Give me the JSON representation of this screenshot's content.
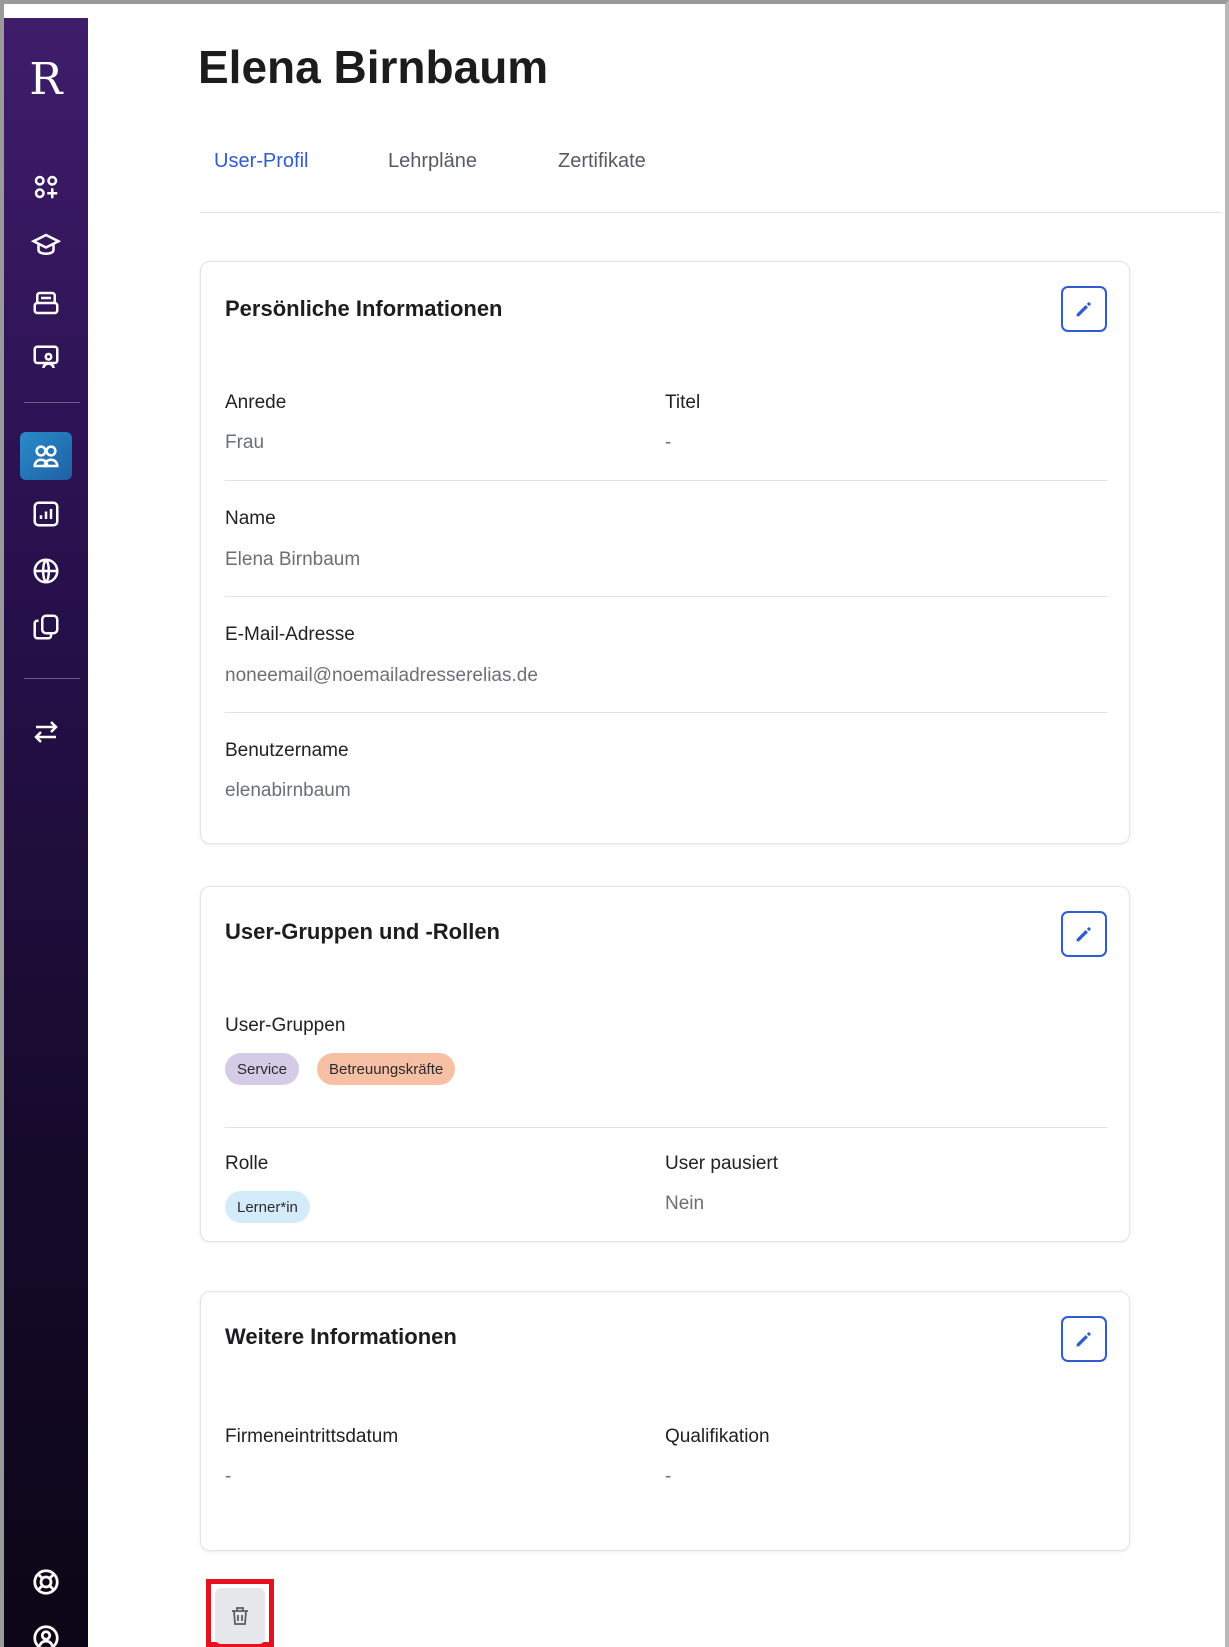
{
  "sidebar": {
    "logo": "R",
    "items": [
      {
        "icon": "dashboard-icon",
        "active": false
      },
      {
        "icon": "graduation-cap-icon",
        "active": false
      },
      {
        "icon": "inbox-icon",
        "active": false
      },
      {
        "icon": "presentation-icon",
        "active": false
      },
      {
        "icon": "users-icon",
        "active": true
      },
      {
        "icon": "report-chart-icon",
        "active": false
      },
      {
        "icon": "globe-icon",
        "active": false
      },
      {
        "icon": "copy-icon",
        "active": false
      },
      {
        "icon": "swap-arrows-icon",
        "active": false
      },
      {
        "icon": "lifebuoy-icon",
        "active": false
      },
      {
        "icon": "user-account-icon",
        "active": false
      }
    ],
    "active_color": "#1e5fa5"
  },
  "page": {
    "title": "Elena Birnbaum"
  },
  "tabs": [
    {
      "label": "User-Profil",
      "active": true
    },
    {
      "label": "Lehrpläne",
      "active": false
    },
    {
      "label": "Zertifikate",
      "active": false
    }
  ],
  "personal": {
    "title": "Persönliche Informationen",
    "anrede_label": "Anrede",
    "anrede_value": "Frau",
    "titel_label": "Titel",
    "titel_value": "-",
    "name_label": "Name",
    "name_value": "Elena Birnbaum",
    "email_label": "E-Mail-Adresse",
    "email_value": "noneemail@noemailadresserelias.de",
    "username_label": "Benutzername",
    "username_value": "elenabirnbaum"
  },
  "groups": {
    "title": "User-Gruppen und -Rollen",
    "groups_label": "User-Gruppen",
    "group_chips": [
      {
        "label": "Service",
        "color": "#d4cce6"
      },
      {
        "label": "Betreuungskräfte",
        "color": "#f7bfa4"
      }
    ],
    "role_label": "Rolle",
    "role_chip": {
      "label": "Lerner*in",
      "color": "#d3ebfa"
    },
    "paused_label": "User pausiert",
    "paused_value": "Nein"
  },
  "more": {
    "title": "Weitere Informationen",
    "entry_label": "Firmeneintrittsdatum",
    "entry_value": "-",
    "qual_label": "Qualifikation",
    "qual_value": "-"
  },
  "delete": {
    "icon": "trash-icon",
    "highlight_color": "#e4121c"
  },
  "colors": {
    "accent": "#2f5bd6"
  }
}
